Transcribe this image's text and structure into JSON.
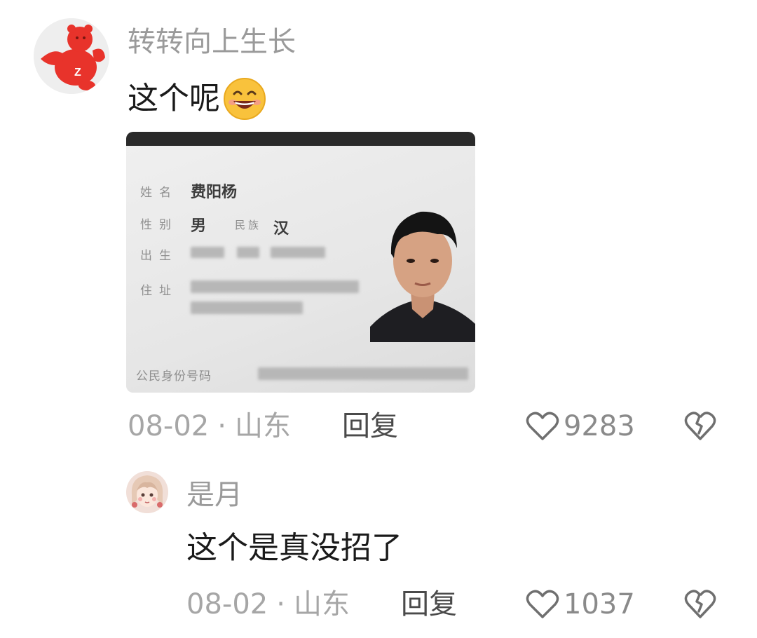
{
  "comments": [
    {
      "username": "转转向上生长",
      "text": "这个呢",
      "emoji": "grinning-face-emoji",
      "image": {
        "labels": {
          "name": "姓名",
          "gender": "性别",
          "ethnicity": "民族",
          "birth": "出生",
          "address": "住址",
          "id_number": "公民身份号码"
        },
        "values": {
          "name": "费阳杨",
          "gender": "男",
          "ethnicity": "汉"
        }
      },
      "date": "08-02",
      "separator": "·",
      "location": "山东",
      "reply_label": "回复",
      "likes": "9283"
    },
    {
      "username": "是月",
      "text": "这个是真没招了",
      "date": "08-02",
      "separator": "·",
      "location": "山东",
      "reply_label": "回复",
      "likes": "1037"
    }
  ],
  "colors": {
    "username": "#9a9a9a",
    "meta": "#a6a6a6",
    "text": "#1a1a1a",
    "avatar_bg": "#ededed",
    "avatar_mascot": "#e8332b"
  }
}
